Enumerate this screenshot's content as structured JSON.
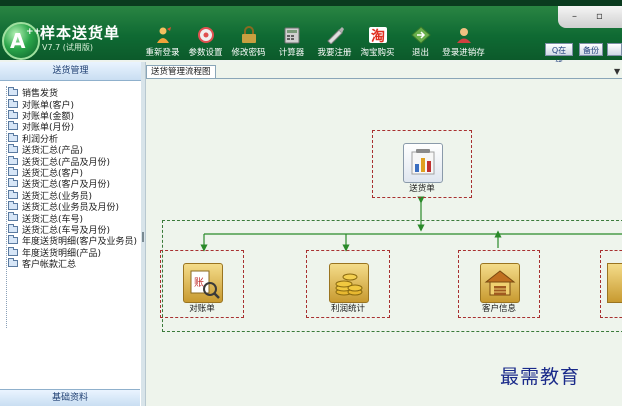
{
  "app": {
    "title": "样本送货单",
    "version": "V7.7 (试用版)",
    "logo_letter": "A",
    "logo_plus": "++"
  },
  "toolbar": [
    {
      "label": "重新登录",
      "icon": "relogin-icon",
      "color": "#f2a33a"
    },
    {
      "label": "参数设置",
      "icon": "settings-icon",
      "color": "#e05050"
    },
    {
      "label": "修改密码",
      "icon": "password-icon",
      "color": "#c8a040"
    },
    {
      "label": "计算器",
      "icon": "calculator-icon",
      "color": "#c0c0c0"
    },
    {
      "label": "我要注册",
      "icon": "register-icon",
      "color": "#e0e0e0"
    },
    {
      "label": "淘宝购买",
      "icon": "taobao-icon",
      "color": "#e03020"
    },
    {
      "label": "退出",
      "icon": "exit-icon",
      "color": "#6ab04c"
    },
    {
      "label": "登录进销存",
      "icon": "login-inventory-icon",
      "color": "#d04040"
    }
  ],
  "header_buttons": {
    "qq": "Q在线",
    "backup": "备份"
  },
  "left_panel": {
    "header": "送货管理",
    "footer": "基础资料",
    "items": [
      "销售发货",
      "对账单(客户)",
      "对账单(金额)",
      "对账单(月份)",
      "利润分析",
      "送货汇总(产品)",
      "送货汇总(产品及月份)",
      "送货汇总(客户)",
      "送货汇总(客户及月份)",
      "送货汇总(业务员)",
      "送货汇总(业务员及月份)",
      "送货汇总(车号)",
      "送货汇总(车号及月份)",
      "年度送货明细(客户及业务员)",
      "年度送货明细(产品)",
      "客户帐款汇总"
    ]
  },
  "main": {
    "tab_label": "送货管理流程图",
    "nodes": [
      {
        "id": "delivery",
        "label": "送货单",
        "icon": "chart-icon"
      },
      {
        "id": "statement",
        "label": "对账单",
        "icon": "statement-icon"
      },
      {
        "id": "profit",
        "label": "利润统计",
        "icon": "coins-icon"
      },
      {
        "id": "customer",
        "label": "客户信息",
        "icon": "customer-icon"
      }
    ]
  },
  "colors": {
    "banner": "#0f6a33",
    "node_border": "#a83030",
    "group_border": "#3a7a3a",
    "arrow": "#2a8a2a"
  },
  "watermark": "最需教育"
}
